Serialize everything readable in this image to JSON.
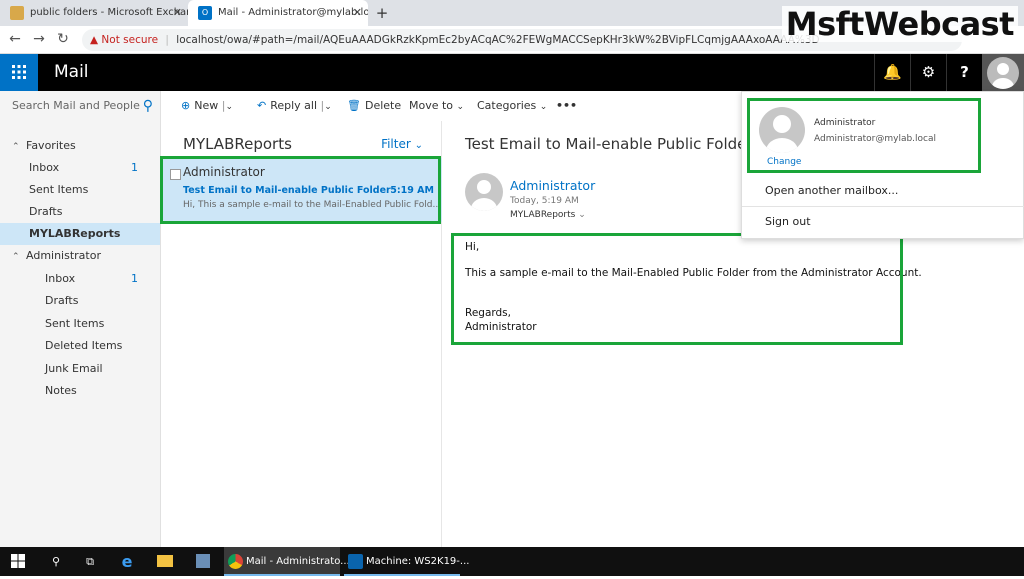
{
  "browser": {
    "tabs": [
      {
        "title": "public folders - Microsoft Exchar",
        "active": false
      },
      {
        "title": "Mail - Administrator@mylab.loca",
        "active": true
      }
    ],
    "new_tab": "+",
    "security": "Not secure",
    "url": "localhost/owa/#path=/mail/AQEuAAADGkRzkKpmEc2byACqAC%2FEWgMACCSepKHr3kW%2BVipFLCqmjgAAAxoAAAA%3D",
    "watermark": "MsftWebcast"
  },
  "header": {
    "app_name": "Mail",
    "accent": "#0072c6"
  },
  "search": {
    "placeholder": "Search Mail and People"
  },
  "nav": {
    "favorites_label": "Favorites",
    "favorites": [
      {
        "label": "Inbox",
        "count": "1"
      },
      {
        "label": "Sent Items",
        "count": ""
      },
      {
        "label": "Drafts",
        "count": ""
      },
      {
        "label": "MYLABReports",
        "count": "",
        "selected": true
      }
    ],
    "account_label": "Administrator",
    "account_folders": [
      {
        "label": "Inbox",
        "count": "1"
      },
      {
        "label": "Drafts",
        "count": ""
      },
      {
        "label": "Sent Items",
        "count": ""
      },
      {
        "label": "Deleted Items",
        "count": ""
      },
      {
        "label": "Junk Email",
        "count": ""
      },
      {
        "label": "Notes",
        "count": ""
      }
    ]
  },
  "toolbar": {
    "new_label": "New",
    "reply_all_label": "Reply all",
    "delete_label": "Delete",
    "move_to_label": "Move to",
    "categories_label": "Categories",
    "more_label": "•••"
  },
  "message_list": {
    "folder_name": "MYLABReports",
    "filter_label": "Filter",
    "items": [
      {
        "sender": "Administrator",
        "subject": "Test Email to Mail-enable Public Folder",
        "time": "5:19 AM",
        "preview": "Hi, This a sample e-mail to the Mail-Enabled Public Fold..."
      }
    ]
  },
  "reading": {
    "subject": "Test Email to Mail-enable Public Folder",
    "from": "Administrator",
    "date": "Today, 5:19 AM",
    "to": "MYLABReports",
    "body": {
      "greeting": "Hi,",
      "line1": "This a sample e-mail to the Mail-Enabled Public Folder from the Administrator Account.",
      "closing": "Regards,",
      "signature": "Administrator"
    }
  },
  "account_menu": {
    "name": "Administrator",
    "email": "Administrator@mylab.local",
    "change_label": "Change",
    "open_another_label": "Open another mailbox...",
    "sign_out_label": "Sign out"
  },
  "taskbar": {
    "apps": [
      {
        "label": "Mail - Administrato..."
      },
      {
        "label": "Machine: WS2K19-..."
      }
    ]
  },
  "highlight_color": "#1aa539"
}
